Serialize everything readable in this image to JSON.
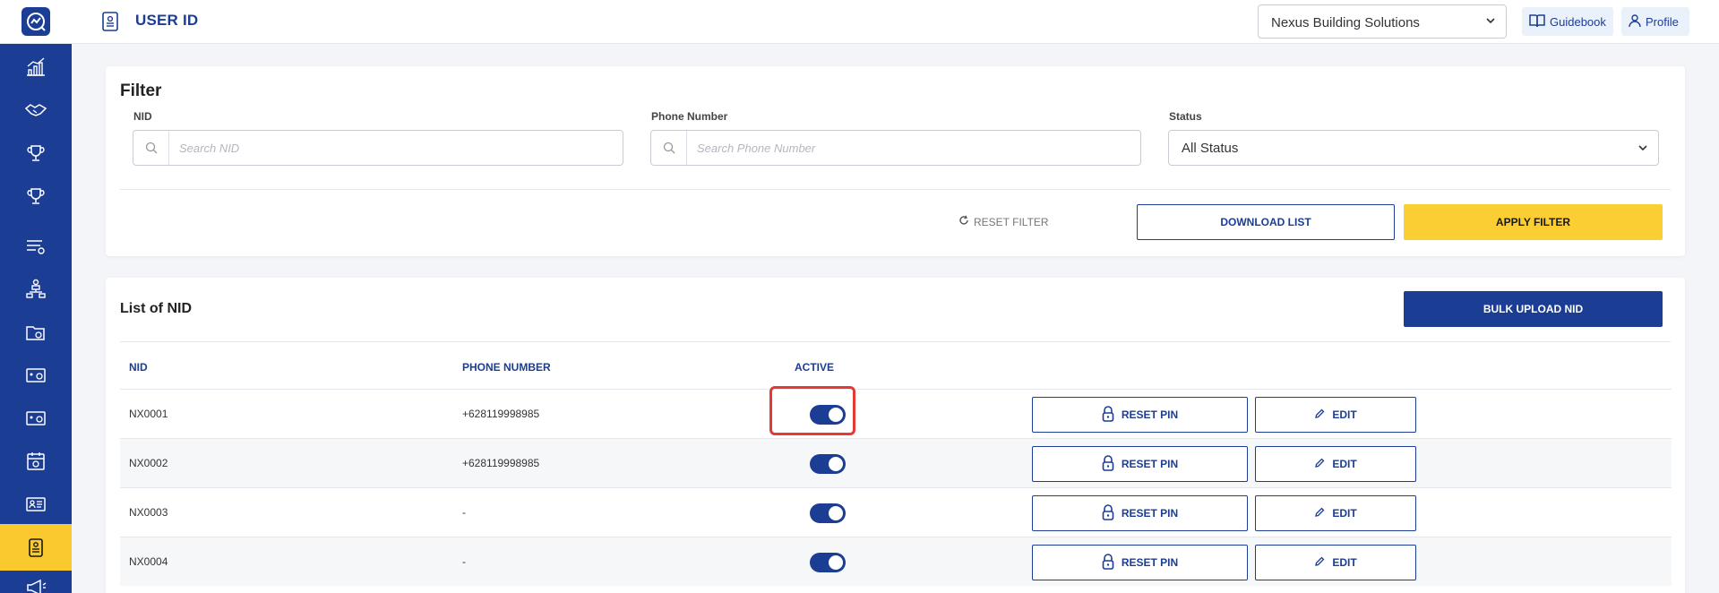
{
  "header": {
    "title": "USER ID",
    "company_select": "Nexus Building Solutions",
    "guidebook_label": "Guidebook",
    "profile_label": "Profile"
  },
  "sidebar": {
    "items": [
      {
        "icon": "chart-growth-icon"
      },
      {
        "icon": "handshake-icon"
      },
      {
        "icon": "trophy-icon"
      },
      {
        "icon": "trophy-icon"
      },
      {
        "icon": "list-settings-icon"
      },
      {
        "icon": "org-chart-icon"
      },
      {
        "icon": "folder-plus-icon"
      },
      {
        "icon": "id-card-settings-icon"
      },
      {
        "icon": "id-card-settings-icon"
      },
      {
        "icon": "calendar-dollar-icon"
      },
      {
        "icon": "contact-card-icon"
      },
      {
        "icon": "user-id-icon",
        "active": true
      },
      {
        "icon": "megaphone-icon"
      }
    ],
    "accent_color": "#1c3d94",
    "active_color": "#f9c92f"
  },
  "filter": {
    "title": "Filter",
    "nid_label": "NID",
    "nid_placeholder": "Search NID",
    "phone_label": "Phone Number",
    "phone_placeholder": "Search Phone Number",
    "status_label": "Status",
    "status_value": "All Status",
    "reset_label": "RESET FILTER",
    "download_label": "DOWNLOAD LIST",
    "apply_label": "APPLY FILTER"
  },
  "list": {
    "title": "List of NID",
    "bulk_upload_label": "BULK UPLOAD NID",
    "columns": [
      "NID",
      "PHONE NUMBER",
      "ACTIVE"
    ],
    "reset_pin_label": "RESET PIN",
    "edit_label": "EDIT",
    "rows": [
      {
        "nid": "NX0001",
        "phone": "+628119998985",
        "active": true
      },
      {
        "nid": "NX0002",
        "phone": "+628119998985",
        "active": true
      },
      {
        "nid": "NX0003",
        "phone": "-",
        "active": true
      },
      {
        "nid": "NX0004",
        "phone": "-",
        "active": true
      }
    ]
  }
}
